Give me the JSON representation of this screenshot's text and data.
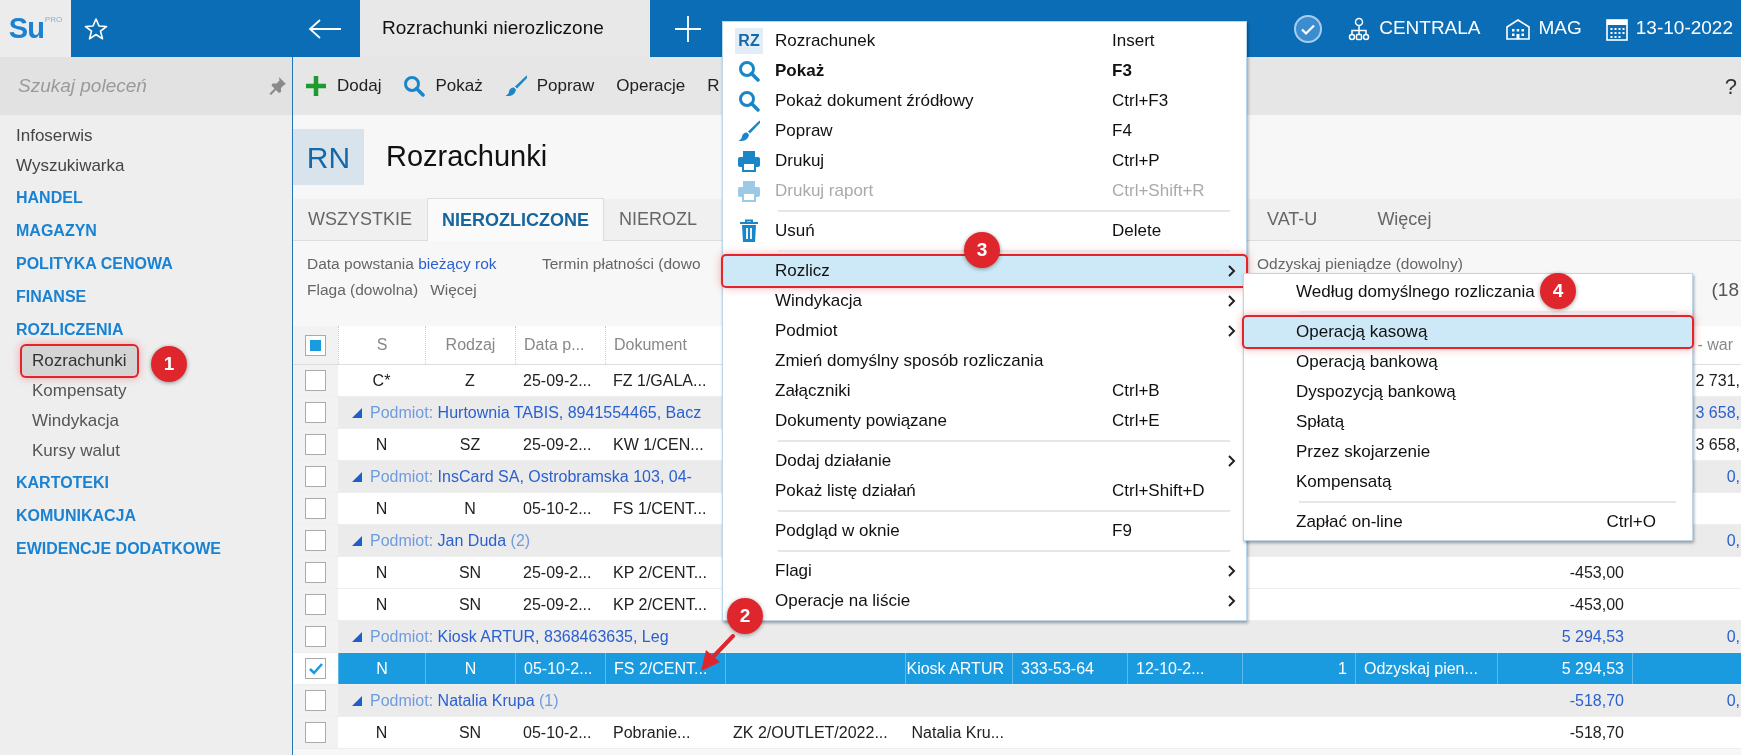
{
  "app_bar": {
    "logo": "Su",
    "logo_badge": "PRO",
    "tab_title": "Rozrachunki nierozliczone",
    "indicators": [
      {
        "kind": "status"
      },
      {
        "kind": "branch",
        "label": "CENTRALA"
      },
      {
        "kind": "warehouse",
        "label": "MAG"
      },
      {
        "kind": "date",
        "label": "13-10-2022"
      }
    ]
  },
  "sidebar": {
    "search": {
      "placeholder": "Szukaj poleceń"
    },
    "items": [
      {
        "kind": "link",
        "label": "Infoserwis"
      },
      {
        "kind": "link",
        "label": "Wyszukiwarka"
      },
      {
        "kind": "section",
        "label": "HANDEL"
      },
      {
        "kind": "section",
        "label": "MAGAZYN"
      },
      {
        "kind": "section",
        "label": "POLITYKA CENOWA"
      },
      {
        "kind": "section",
        "label": "FINANSE"
      },
      {
        "kind": "section",
        "label": "ROZLICZENIA",
        "children": [
          {
            "label": "Rozrachunki",
            "selected": true,
            "callout": true
          },
          {
            "label": "Kompensaty",
            "selected": false,
            "callout": false
          },
          {
            "label": "Windykacja",
            "selected": false,
            "callout": false
          },
          {
            "label": "Kursy walut",
            "selected": false,
            "callout": false
          }
        ]
      },
      {
        "kind": "section",
        "label": "KARTOTEKI"
      },
      {
        "kind": "section",
        "label": "KOMUNIKACJA"
      },
      {
        "kind": "section",
        "label": "EWIDENCJE DODATKOWE"
      }
    ]
  },
  "toolbar": {
    "buttons": [
      {
        "label": "Dodaj"
      },
      {
        "label": "Pokaż"
      },
      {
        "label": "Popraw"
      },
      {
        "label": "Operacje"
      },
      {
        "label": "R"
      }
    ],
    "help": "?"
  },
  "page_header": {
    "badge": "RN",
    "title": "Rozrachunki"
  },
  "tabs": [
    {
      "label": "WSZYSTKIE",
      "selected": false
    },
    {
      "label": "NIEROZLICZONE",
      "selected": true
    },
    {
      "label": "NIEROZL",
      "selected": false
    },
    {
      "label": "VAT-U",
      "selected": false
    },
    {
      "label": "Więcej",
      "selected": false
    }
  ],
  "filters": {
    "lines": [
      [
        {
          "label": "Data powstania",
          "value": "bieżący rok"
        },
        {
          "label": "Termin płatności (dowo"
        },
        {
          "label": "Odzyskaj pieniądze (dowolny)"
        }
      ],
      [
        {
          "label": "Flaga (dowolna)"
        },
        {
          "label": "Więcej"
        }
      ]
    ],
    "record_count": "(18"
  },
  "table": {
    "select_all_indeterminate": true,
    "columns": [
      "S",
      "Rodzaj",
      "Data p...",
      "Dokument",
      null,
      null,
      null,
      null,
      null,
      null,
      null,
      "- war"
    ],
    "rows": [
      {
        "kind": "item",
        "checked": false,
        "selected": false,
        "cells": [
          "C*",
          "Z",
          "25-09-2...",
          "FZ 1/GALA...",
          null,
          null,
          null,
          null,
          null,
          null,
          null,
          "2 731,"
        ]
      },
      {
        "kind": "group",
        "checked": false,
        "selected": false,
        "label": "Podmiot:",
        "name": "Hurtownia TABIS, 8941554465, Bacz",
        "amount": null,
        "amount_2": "3 658,"
      },
      {
        "kind": "item",
        "checked": false,
        "selected": false,
        "cells": [
          "N",
          "SZ",
          "25-09-2...",
          "KW 1/CEN...",
          null,
          null,
          null,
          null,
          null,
          null,
          null,
          "3 658,"
        ]
      },
      {
        "kind": "group",
        "checked": false,
        "selected": false,
        "label": "Podmiot:",
        "name": "InsCard SA, Ostrobramska 103, 04-",
        "amount": null,
        "amount_2": "0,"
      },
      {
        "kind": "item",
        "checked": false,
        "selected": false,
        "cells": [
          "N",
          "N",
          "05-10-2...",
          "FS 1/CENT...",
          null,
          null,
          null,
          null,
          null,
          null,
          null,
          null
        ]
      },
      {
        "kind": "group",
        "checked": false,
        "selected": false,
        "label": "Podmiot:",
        "name": "Jan Duda",
        "count": "(2)",
        "amount": null,
        "amount_2": "0,"
      },
      {
        "kind": "item",
        "checked": false,
        "selected": false,
        "cells": [
          "N",
          "SN",
          "25-09-2...",
          "KP 2/CENT...",
          null,
          null,
          null,
          null,
          null,
          null,
          "-453,00",
          null
        ]
      },
      {
        "kind": "item",
        "checked": false,
        "selected": false,
        "cells": [
          "N",
          "SN",
          "25-09-2...",
          "KP 2/CENT...",
          null,
          null,
          null,
          null,
          null,
          null,
          "-453,00",
          null
        ]
      },
      {
        "kind": "group",
        "checked": false,
        "selected": false,
        "label": "Podmiot:",
        "name": "Kiosk ARTUR, 8368463635, Leg",
        "amount": "5 294,53",
        "amount_2": "0,"
      },
      {
        "kind": "item",
        "checked": true,
        "selected": true,
        "cells": [
          "N",
          "N",
          "05-10-2...",
          "FS 2/CENT...",
          null,
          "Kiosk ARTUR",
          "333-53-64",
          "12-10-2...",
          "1",
          "Odzyskaj pien...",
          "5 294,53",
          null
        ]
      },
      {
        "kind": "group",
        "checked": false,
        "selected": false,
        "label": "Podmiot:",
        "name": "Natalia Krupa",
        "count": "(1)",
        "amount": "-518,70",
        "amount_2": "0,"
      },
      {
        "kind": "item",
        "checked": false,
        "selected": false,
        "cells": [
          "N",
          "SN",
          "05-10-2...",
          "Pobranie...",
          "ZK 2/OUTLET/2022...",
          "Natalia Kru...",
          null,
          null,
          null,
          null,
          "-518,70",
          null
        ]
      }
    ]
  },
  "context_menu": {
    "items": [
      {
        "kind": "item",
        "icon_text": "RZ",
        "label": "Rozrachunek",
        "shortcut": "Insert",
        "default": false,
        "disabled": false,
        "highlighted": false,
        "submenu": false,
        "callout": false
      },
      {
        "kind": "item",
        "label": "Pokaż",
        "shortcut": "F3",
        "default": true,
        "disabled": false,
        "highlighted": false,
        "submenu": false,
        "callout": false
      },
      {
        "kind": "item",
        "label": "Pokaż dokument źródłowy",
        "shortcut": "Ctrl+F3",
        "default": false,
        "disabled": false,
        "highlighted": false,
        "submenu": false,
        "callout": false
      },
      {
        "kind": "item",
        "label": "Popraw",
        "shortcut": "F4",
        "default": false,
        "disabled": false,
        "highlighted": false,
        "submenu": false,
        "callout": false
      },
      {
        "kind": "item",
        "label": "Drukuj",
        "shortcut": "Ctrl+P",
        "default": false,
        "disabled": false,
        "highlighted": false,
        "submenu": false,
        "callout": false
      },
      {
        "kind": "item",
        "label": "Drukuj raport",
        "shortcut": "Ctrl+Shift+R",
        "default": false,
        "disabled": true,
        "highlighted": false,
        "submenu": false,
        "callout": false
      },
      {
        "kind": "separator"
      },
      {
        "kind": "item",
        "label": "Usuń",
        "shortcut": "Delete",
        "default": false,
        "disabled": false,
        "highlighted": false,
        "submenu": false,
        "callout": false
      },
      {
        "kind": "separator"
      },
      {
        "kind": "item",
        "label": "Rozlicz",
        "default": false,
        "disabled": false,
        "highlighted": true,
        "submenu": true,
        "callout": true
      },
      {
        "kind": "item",
        "label": "Windykacja",
        "default": false,
        "disabled": false,
        "highlighted": false,
        "submenu": true,
        "callout": false
      },
      {
        "kind": "item",
        "label": "Podmiot",
        "default": false,
        "disabled": false,
        "highlighted": false,
        "submenu": true,
        "callout": false
      },
      {
        "kind": "item",
        "label": "Zmień domyślny sposób rozliczania",
        "default": false,
        "disabled": false,
        "highlighted": false,
        "submenu": false,
        "callout": false
      },
      {
        "kind": "item",
        "label": "Załączniki",
        "shortcut": "Ctrl+B",
        "default": false,
        "disabled": false,
        "highlighted": false,
        "submenu": false,
        "callout": false
      },
      {
        "kind": "item",
        "label": "Dokumenty powiązane",
        "shortcut": "Ctrl+E",
        "default": false,
        "disabled": false,
        "highlighted": false,
        "submenu": false,
        "callout": false
      },
      {
        "kind": "separator"
      },
      {
        "kind": "item",
        "label": "Dodaj działanie",
        "default": false,
        "disabled": false,
        "highlighted": false,
        "submenu": true,
        "callout": false
      },
      {
        "kind": "item",
        "label": "Pokaż listę działań",
        "shortcut": "Ctrl+Shift+D",
        "default": false,
        "disabled": false,
        "highlighted": false,
        "submenu": false,
        "callout": false
      },
      {
        "kind": "separator"
      },
      {
        "kind": "item",
        "label": "Podgląd w oknie",
        "shortcut": "F9",
        "default": false,
        "disabled": false,
        "highlighted": false,
        "submenu": false,
        "callout": false
      },
      {
        "kind": "separator"
      },
      {
        "kind": "item",
        "label": "Flagi",
        "default": false,
        "disabled": false,
        "highlighted": false,
        "submenu": true,
        "callout": false
      },
      {
        "kind": "item",
        "label": "Operacje na liście",
        "default": false,
        "disabled": false,
        "highlighted": false,
        "submenu": true,
        "callout": false
      }
    ]
  },
  "submenu": {
    "items": [
      {
        "kind": "item",
        "label": "Według domyślnego rozliczania",
        "highlighted": false,
        "callout": false
      },
      {
        "kind": "separator"
      },
      {
        "kind": "item",
        "label": "Operacją kasową",
        "highlighted": true,
        "callout": true
      },
      {
        "kind": "item",
        "label": "Operacją bankową",
        "highlighted": false,
        "callout": false
      },
      {
        "kind": "item",
        "label": "Dyspozycją bankową",
        "highlighted": false,
        "callout": false
      },
      {
        "kind": "item",
        "label": "Spłatą",
        "highlighted": false,
        "callout": false
      },
      {
        "kind": "item",
        "label": "Przez skojarzenie",
        "highlighted": false,
        "callout": false
      },
      {
        "kind": "item",
        "label": "Kompensatą",
        "highlighted": false,
        "callout": false
      },
      {
        "kind": "separator"
      },
      {
        "kind": "item",
        "label": "Zapłać on-line",
        "shortcut": "Ctrl+O",
        "highlighted": false,
        "callout": false
      }
    ]
  },
  "annotations": [
    {
      "kind": "badge",
      "label": "1"
    },
    {
      "kind": "badge",
      "label": "2"
    },
    {
      "kind": "arrow"
    },
    {
      "kind": "badge",
      "label": "3"
    },
    {
      "kind": "badge",
      "label": "4"
    }
  ]
}
